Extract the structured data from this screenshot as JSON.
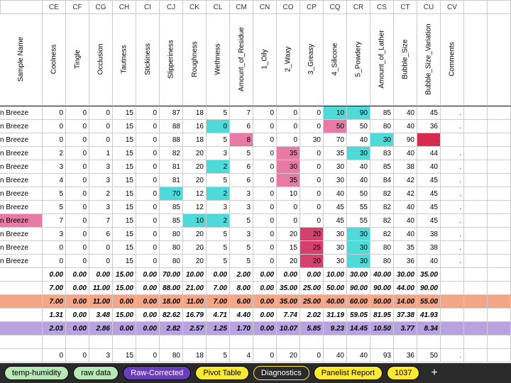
{
  "columns": [
    "",
    "CE",
    "CF",
    "CG",
    "CH",
    "CI",
    "CJ",
    "CK",
    "CL",
    "CM",
    "CN",
    "CO",
    "CP",
    "CQ",
    "CR",
    "CS",
    "CT",
    "CU",
    "CV"
  ],
  "fields": [
    "Sample Name",
    "Coolness",
    "Tingle",
    "Occlusion",
    "Tautness",
    "Stickiness",
    "Slipperiness",
    "Roughness",
    "Wethness",
    "Amount_of_Residue",
    "1_Oily",
    "2_Waxy",
    "3_Greasy",
    "4_Silicone",
    "5_Powdery",
    "Amount_of_Lather",
    "Bubble_Size",
    "Bubble_Size_Variation",
    "Comments"
  ],
  "rows": [
    {
      "name": "n Breeze",
      "v": [
        "0",
        "0",
        "0",
        "15",
        "0",
        "87",
        "18",
        "5",
        "7",
        "0",
        "0",
        "0",
        "10",
        "90",
        "85",
        "40",
        "45",
        "."
      ],
      "hl": {
        "12": "cyan",
        "13": "cyan"
      }
    },
    {
      "name": "n Breeze",
      "v": [
        "0",
        "0",
        "0",
        "15",
        "0",
        "88",
        "16",
        "0",
        "6",
        "0",
        "0",
        "0",
        "50",
        "50",
        "80",
        "40",
        "36",
        "."
      ],
      "hl": {
        "7": "cyan",
        "12": "pink"
      }
    },
    {
      "name": "n Breeze",
      "v": [
        "0",
        "0",
        "0",
        "15",
        "0",
        "88",
        "18",
        "5",
        "8",
        "0",
        "0",
        "30",
        "70",
        "40",
        "30",
        "90",
        ".",
        ""
      ],
      "hl": {
        "8": "pink",
        "14": "cyan",
        "16": "red"
      },
      "nameHl": ""
    },
    {
      "name": "n Breeze",
      "v": [
        "2",
        "0",
        "1",
        "15",
        "0",
        "82",
        "20",
        "3",
        "5",
        "0",
        "35",
        "0",
        "35",
        "30",
        "83",
        "40",
        "44",
        "."
      ],
      "hl": {
        "10": "pink",
        "13": "cyan"
      }
    },
    {
      "name": "n Breeze",
      "v": [
        "3",
        "0",
        "3",
        "15",
        "0",
        "81",
        "20",
        "2",
        "6",
        "0",
        "30",
        "0",
        "30",
        "40",
        "85",
        "38",
        "40",
        "."
      ],
      "hl": {
        "7": "cyan",
        "10": "pink"
      }
    },
    {
      "name": "n Breeze",
      "v": [
        "4",
        "0",
        "3",
        "15",
        "0",
        "81",
        "20",
        "5",
        "6",
        "0",
        "35",
        "0",
        "30",
        "40",
        "84",
        "42",
        "45",
        "."
      ],
      "hl": {
        "10": "pink"
      }
    },
    {
      "name": "n Breeze",
      "v": [
        "5",
        "0",
        "2",
        "15",
        "0",
        "70",
        "12",
        "2",
        "3",
        "0",
        "10",
        "0",
        "40",
        "50",
        "82",
        "42",
        "45",
        "."
      ],
      "hl": {
        "5": "cyan",
        "7": "cyan"
      }
    },
    {
      "name": "n Breeze",
      "v": [
        "5",
        "0",
        "3",
        "15",
        "0",
        "85",
        "12",
        "3",
        "3",
        "0",
        "0",
        "0",
        "45",
        "55",
        "82",
        "40",
        "45",
        "."
      ]
    },
    {
      "name": "n Breeze",
      "v": [
        "7",
        "0",
        "7",
        "15",
        "0",
        "85",
        "10",
        "2",
        "5",
        "0",
        "0",
        "0",
        "45",
        "55",
        "82",
        "40",
        "45",
        "."
      ],
      "hl": {
        "6": "cyan",
        "7": "cyan"
      },
      "nameHl": "pink"
    },
    {
      "name": "n Breeze",
      "v": [
        "3",
        "0",
        "6",
        "15",
        "0",
        "80",
        "20",
        "5",
        "3",
        "0",
        "20",
        "20",
        "30",
        "30",
        "82",
        "40",
        "38",
        "."
      ],
      "hl": {
        "11": "deeppink",
        "13": "cyan"
      }
    },
    {
      "name": "n Breeze",
      "v": [
        "0",
        "0",
        "0",
        "15",
        "0",
        "80",
        "20",
        "5",
        "5",
        "0",
        "15",
        "25",
        "30",
        "30",
        "80",
        "35",
        "38",
        "."
      ],
      "hl": {
        "11": "deeppink",
        "13": "cyan"
      }
    },
    {
      "name": "n Breeze",
      "v": [
        "0",
        "0",
        "0",
        "15",
        "0",
        "80",
        "20",
        "5",
        "5",
        "0",
        "20",
        "20",
        "30",
        "30",
        "80",
        "36",
        "40",
        "."
      ],
      "hl": {
        "11": "deeppink",
        "13": "cyan"
      }
    }
  ],
  "summary": [
    {
      "v": [
        "0.00",
        "0.00",
        "0.00",
        "15.00",
        "0.00",
        "70.00",
        "10.00",
        "0.00",
        "2.00",
        "0.00",
        "0.00",
        "0.00",
        "10.00",
        "30.00",
        "40.00",
        "30.00",
        "35.00"
      ]
    },
    {
      "v": [
        "7.00",
        "0.00",
        "11.00",
        "15.00",
        "0.00",
        "88.00",
        "21.00",
        "7.00",
        "8.00",
        "0.00",
        "35.00",
        "25.00",
        "50.00",
        "90.00",
        "90.00",
        "44.00",
        "90.00"
      ]
    },
    {
      "v": [
        "7.00",
        "0.00",
        "11.00",
        "0.00",
        "0.00",
        "18.00",
        "11.00",
        "7.00",
        "6.00",
        "0.00",
        "35.00",
        "25.00",
        "40.00",
        "60.00",
        "50.00",
        "14.00",
        "55.00"
      ],
      "rowHl": "salmon"
    },
    {
      "v": [
        "1.31",
        "0.00",
        "3.48",
        "15.00",
        "0.00",
        "82.62",
        "16.79",
        "4.71",
        "4.40",
        "0.00",
        "7.74",
        "2.02",
        "31.19",
        "59.05",
        "81.95",
        "37.38",
        "41.93"
      ]
    },
    {
      "v": [
        "2.03",
        "0.00",
        "2.86",
        "0.00",
        "0.00",
        "2.82",
        "2.57",
        "1.25",
        "1.70",
        "0.00",
        "10.07",
        "5.85",
        "9.23",
        "14.45",
        "10.50",
        "3.77",
        "8.34"
      ],
      "rowHl": "lav",
      "hl": {
        "10": "lav",
        "13": "lav",
        "14": "lav"
      }
    }
  ],
  "footer": [
    "0",
    "0",
    "3",
    "15",
    "0",
    "80",
    "18",
    "5",
    "4",
    "0",
    "20",
    "0",
    "40",
    "40",
    "93",
    "36",
    "50",
    "."
  ],
  "tabs": [
    {
      "label": "temp-humidity",
      "cls": "green"
    },
    {
      "label": "raw data",
      "cls": "green"
    },
    {
      "label": "Raw-Corrected",
      "cls": "purple"
    },
    {
      "label": "Pivot Table",
      "cls": "yellow"
    },
    {
      "label": "Diagnostics",
      "cls": "yelloutline"
    },
    {
      "label": "Panelist Report",
      "cls": "yellow"
    },
    {
      "label": "1037",
      "cls": "yellow"
    }
  ],
  "addTab": "+"
}
